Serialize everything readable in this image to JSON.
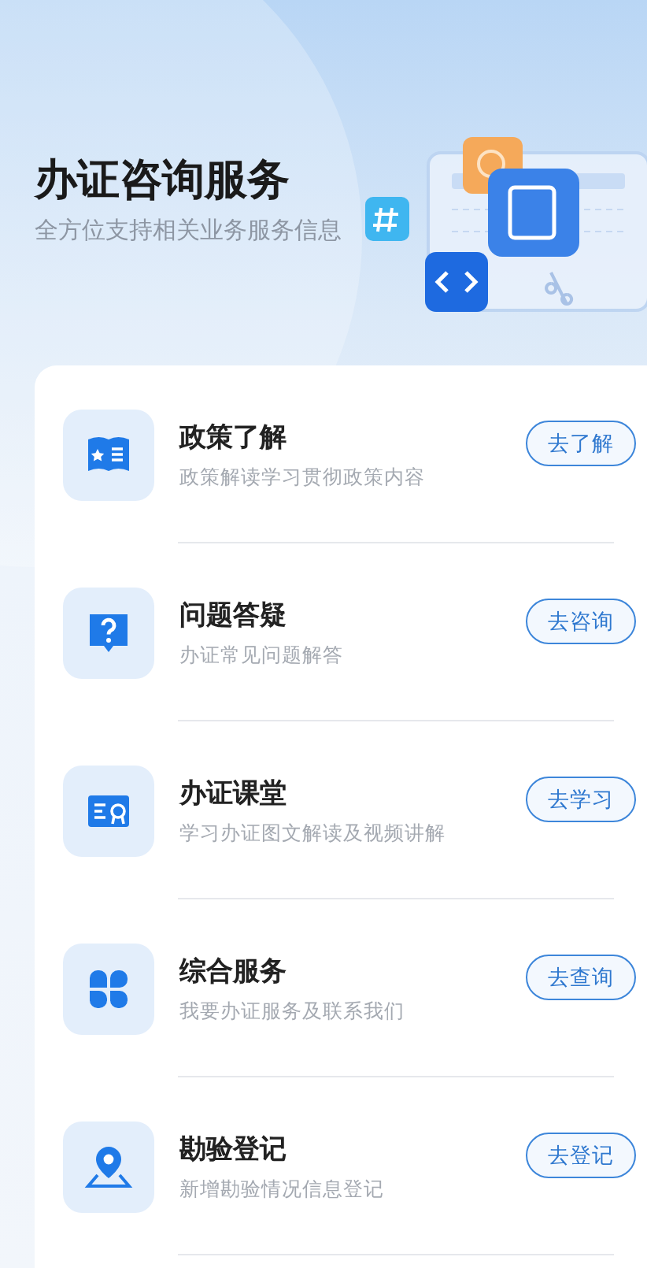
{
  "header": {
    "title": "办证咨询服务",
    "subtitle": "全方位支持相关业务服务信息"
  },
  "services": [
    {
      "kind": "book",
      "title": "政策了解",
      "description": "政策解读学习贯彻政策内容",
      "action": "去了解"
    },
    {
      "kind": "question",
      "title": "问题答疑",
      "description": "办证常见问题解答",
      "action": "去咨询"
    },
    {
      "kind": "certificate",
      "title": "办证课堂",
      "description": "学习办证图文解读及视频讲解",
      "action": "去学习"
    },
    {
      "kind": "grid",
      "title": "综合服务",
      "description": "我要办证服务及联系我们",
      "action": "去查询"
    },
    {
      "kind": "location",
      "title": "勘验登记",
      "description": "新增勘验情况信息登记",
      "action": "去登记"
    }
  ]
}
